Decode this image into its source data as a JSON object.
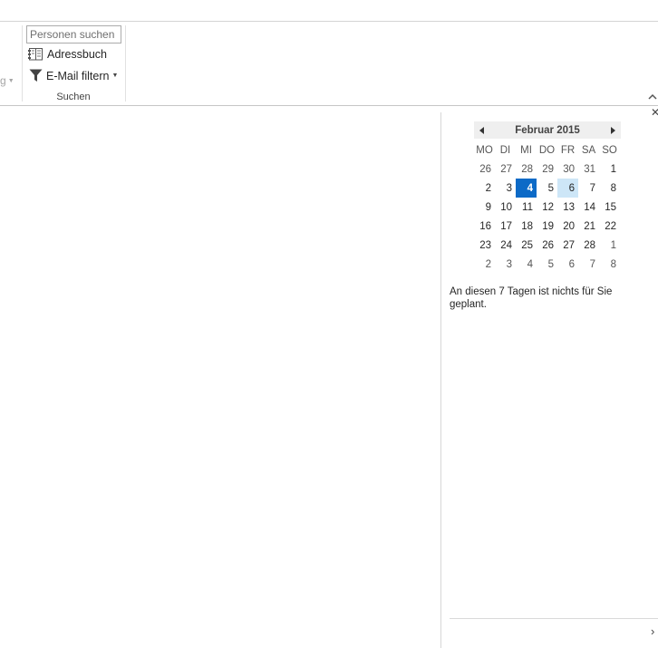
{
  "ribbon": {
    "prev_group_label": "g",
    "search_group": {
      "search_placeholder": "Personen suchen",
      "address_book_label": "Adressbuch",
      "filter_email_label": "E-Mail filtern",
      "group_label": "Suchen"
    }
  },
  "calendar": {
    "title": "Februar 2015",
    "weekdays": [
      "MO",
      "DI",
      "MI",
      "DO",
      "FR",
      "SA",
      "SO"
    ],
    "weeks": [
      [
        "26",
        "27",
        "28",
        "29",
        "30",
        "31",
        "1"
      ],
      [
        "2",
        "3",
        "4",
        "5",
        "6",
        "7",
        "8"
      ],
      [
        "9",
        "10",
        "11",
        "12",
        "13",
        "14",
        "15"
      ],
      [
        "16",
        "17",
        "18",
        "19",
        "20",
        "21",
        "22"
      ],
      [
        "23",
        "24",
        "25",
        "26",
        "27",
        "28",
        "1"
      ],
      [
        "2",
        "3",
        "4",
        "5",
        "6",
        "7",
        "8"
      ]
    ],
    "today_day": "4",
    "selected_day": "6"
  },
  "peek": {
    "no_events_text": "An diesen 7 Tagen ist nichts für Sie geplant."
  },
  "colors": {
    "today_bg": "#0c6ac7",
    "selected_bg": "#cde6f7"
  }
}
